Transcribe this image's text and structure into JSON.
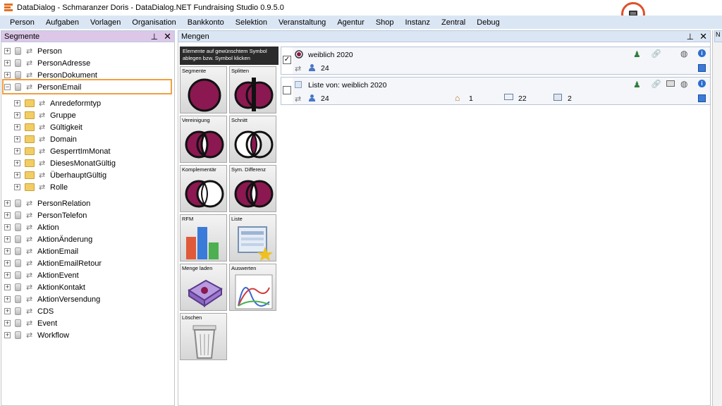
{
  "window": {
    "title": "DataDialog - Schmaranzer Doris - DataDialog.NET Fundraising Studio 0.9.5.0"
  },
  "menu": [
    "Person",
    "Aufgaben",
    "Vorlagen",
    "Organisation",
    "Bankkonto",
    "Selektion",
    "Veranstaltung",
    "Agentur",
    "Shop",
    "Instanz",
    "Zentral",
    "Debug"
  ],
  "left_pane": {
    "title": "Segmente",
    "tree": [
      {
        "label": "Person",
        "level": 0,
        "icon": "database-icon"
      },
      {
        "label": "PersonAdresse",
        "level": 0,
        "icon": "database-icon"
      },
      {
        "label": "PersonDokument",
        "level": 0,
        "icon": "database-icon"
      },
      {
        "label": "PersonEmail",
        "level": 0,
        "icon": "database-icon",
        "expanded": true,
        "selected": true
      },
      {
        "label": "Anredeformtyp",
        "level": 1,
        "icon": "folder-icon"
      },
      {
        "label": "Gruppe",
        "level": 1,
        "icon": "folder-icon"
      },
      {
        "label": "Gültigkeit",
        "level": 1,
        "icon": "folder-icon"
      },
      {
        "label": "Domain",
        "level": 1,
        "icon": "folder-icon"
      },
      {
        "label": "GesperrtImMonat",
        "level": 1,
        "icon": "folder-icon"
      },
      {
        "label": "DiesesMonatGültig",
        "level": 1,
        "icon": "folder-icon"
      },
      {
        "label": "ÜberhauptGültig",
        "level": 1,
        "icon": "folder-icon"
      },
      {
        "label": "Rolle",
        "level": 1,
        "icon": "folder-icon"
      },
      {
        "label": "PersonRelation",
        "level": 0,
        "icon": "database-icon"
      },
      {
        "label": "PersonTelefon",
        "level": 0,
        "icon": "database-icon"
      },
      {
        "label": "Aktion",
        "level": 0,
        "icon": "database-icon"
      },
      {
        "label": "AktionÄnderung",
        "level": 0,
        "icon": "database-icon"
      },
      {
        "label": "AktionEmail",
        "level": 0,
        "icon": "database-icon"
      },
      {
        "label": "AktionEmailRetour",
        "level": 0,
        "icon": "database-icon"
      },
      {
        "label": "AktionEvent",
        "level": 0,
        "icon": "database-icon"
      },
      {
        "label": "AktionKontakt",
        "level": 0,
        "icon": "database-icon"
      },
      {
        "label": "AktionVersendung",
        "level": 0,
        "icon": "database-icon"
      },
      {
        "label": "CDS",
        "level": 0,
        "icon": "database-icon"
      },
      {
        "label": "Event",
        "level": 0,
        "icon": "database-icon"
      },
      {
        "label": "Workflow",
        "level": 0,
        "icon": "database-icon"
      }
    ]
  },
  "mid_pane": {
    "title": "Mengen",
    "palette_hint": "Elemente auf gewünschtem Symbol ablegen bzw. Symbol klicken",
    "tiles": [
      {
        "label": "Segmente",
        "icon": "segment-circle-icon"
      },
      {
        "label": "Splitten",
        "icon": "split-icon"
      },
      {
        "label": "Vereinigung",
        "icon": "union-icon"
      },
      {
        "label": "Schnitt",
        "icon": "intersection-icon"
      },
      {
        "label": "Komplementär",
        "icon": "complement-icon"
      },
      {
        "label": "Sym. Differenz",
        "icon": "symmetric-difference-icon"
      },
      {
        "label": "RFM",
        "icon": "rfm-bar-chart-icon"
      },
      {
        "label": "Liste",
        "icon": "list-icon"
      },
      {
        "label": "Menge laden",
        "icon": "load-set-icon"
      },
      {
        "label": "Auswerten",
        "icon": "evaluate-chart-icon"
      },
      {
        "label": "Löschen",
        "icon": "trash-icon"
      }
    ],
    "sets": [
      {
        "title": "weiblich 2020",
        "checked": true,
        "count": "24"
      },
      {
        "title": "Liste von: weiblich 2020",
        "checked": false,
        "count": "24",
        "households": "1",
        "emails": "22",
        "addresses": "2"
      }
    ]
  },
  "right_strip": {
    "tab_label": "N"
  },
  "colors": {
    "accent_menu": "#dbe6f4",
    "active_header": "#dcc7e8",
    "highlight_box": "#f0a040",
    "badge_ring": "#e0502a",
    "venn_fill": "#8b1850"
  }
}
